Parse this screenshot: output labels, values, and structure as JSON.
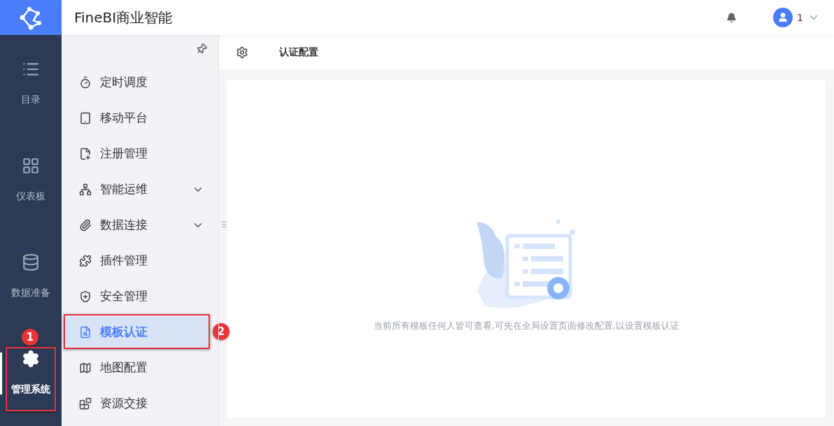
{
  "app": {
    "title": "FineBI商业智能"
  },
  "user": {
    "name": "1"
  },
  "rail": [
    {
      "label": "目录",
      "selected": false,
      "highlighted": false
    },
    {
      "label": "仪表板",
      "selected": false,
      "highlighted": false
    },
    {
      "label": "数据准备",
      "selected": false,
      "highlighted": false
    },
    {
      "label": "管理系统",
      "selected": true,
      "highlighted": true,
      "badge": "1"
    }
  ],
  "menu": [
    {
      "label": "定时调度",
      "expandable": false,
      "selected": false,
      "highlighted": false
    },
    {
      "label": "移动平台",
      "expandable": false,
      "selected": false,
      "highlighted": false
    },
    {
      "label": "注册管理",
      "expandable": false,
      "selected": false,
      "highlighted": false
    },
    {
      "label": "智能运维",
      "expandable": true,
      "selected": false,
      "highlighted": false
    },
    {
      "label": "数据连接",
      "expandable": true,
      "selected": false,
      "highlighted": false
    },
    {
      "label": "插件管理",
      "expandable": false,
      "selected": false,
      "highlighted": false
    },
    {
      "label": "安全管理",
      "expandable": false,
      "selected": false,
      "highlighted": false
    },
    {
      "label": "模板认证",
      "expandable": false,
      "selected": true,
      "highlighted": true,
      "badge": "2"
    },
    {
      "label": "地图配置",
      "expandable": false,
      "selected": false,
      "highlighted": false
    },
    {
      "label": "资源交接",
      "expandable": false,
      "selected": false,
      "highlighted": false
    }
  ],
  "page": {
    "title": "认证配置",
    "empty_message": "当前所有模板任何人皆可查看,可先在全局设置页面修改配置,以设置模板认证"
  }
}
